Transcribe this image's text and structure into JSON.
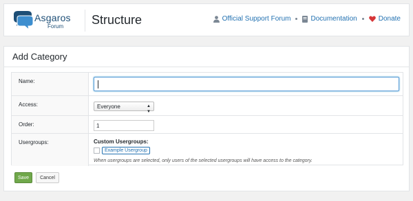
{
  "header": {
    "logo_name": "Asgaros",
    "logo_sub": "Forum",
    "page_title": "Structure",
    "links": [
      {
        "label": "Official Support Forum",
        "icon": "user-icon"
      },
      {
        "label": "Documentation",
        "icon": "book-icon"
      },
      {
        "label": "Donate",
        "icon": "heart-icon"
      }
    ]
  },
  "panel": {
    "title": "Add Category",
    "fields": {
      "name_label": "Name:",
      "name_value": "",
      "access_label": "Access:",
      "access_value": "Everyone",
      "order_label": "Order:",
      "order_value": "1",
      "usergroups_label": "Usergroups:",
      "usergroups_title": "Custom Usergroups:",
      "usergroup_tag": "Example Usergroup",
      "usergroups_desc": "When usergroups are selected, only users of the selected usergroups will have access to the category."
    },
    "buttons": {
      "save": "Save",
      "cancel": "Cancel"
    }
  },
  "colors": {
    "accent": "#2271b1",
    "save": "#70a84b",
    "donate_heart": "#d63638"
  }
}
